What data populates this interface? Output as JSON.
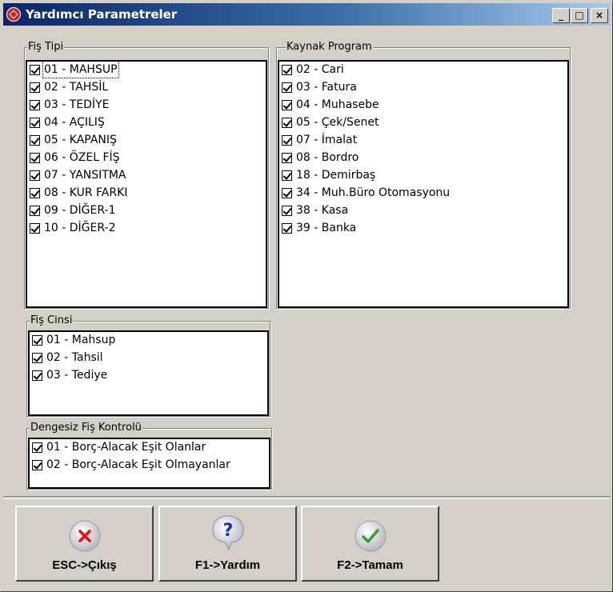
{
  "window": {
    "title": "Yardımcı Parametreler"
  },
  "titlebar_buttons": {
    "minimize": "_",
    "maximize": "□",
    "close": "×"
  },
  "fis_tipi": {
    "legend": "Fiş Tipi",
    "items": [
      "01 - MAHSUP",
      "02 - TAHSİL",
      "03 - TEDİYE",
      "04 - AÇILIŞ",
      "05 - KAPANIŞ",
      "06 - ÖZEL FİŞ",
      "07 - YANSITMA",
      "08 - KUR FARKI",
      "09 - DİĞER-1",
      "10 - DİĞER-2"
    ]
  },
  "kaynak_program": {
    "legend": "Kaynak Program",
    "items": [
      "02 - Cari",
      "03 - Fatura",
      "04 - Muhasebe",
      "05 - Çek/Senet",
      "07 - İmalat",
      "08 - Bordro",
      "18 - Demirbaş",
      "34 - Muh.Büro Otomasyonu",
      "38 - Kasa",
      "39 - Banka"
    ]
  },
  "fis_cinsi": {
    "legend": "Fiş Cinsi",
    "items": [
      "01 - Mahsup",
      "02 - Tahsil",
      "03 - Tediye"
    ]
  },
  "dengesiz": {
    "legend": "Dengesiz Fiş Kontrolü",
    "items": [
      "01 - Borç-Alacak Eşit Olanlar",
      "02 - Borç-Alacak Eşit Olmayanlar"
    ]
  },
  "buttons": {
    "exit": {
      "label": "ESC->Çıkış",
      "icon": "close-icon",
      "color": "#e01010"
    },
    "help": {
      "label": "F1->Yardım",
      "icon": "help-icon",
      "color": "#1030c0"
    },
    "ok": {
      "label": "F2->Tamam",
      "icon": "check-icon",
      "color": "#3a9a3a"
    }
  }
}
